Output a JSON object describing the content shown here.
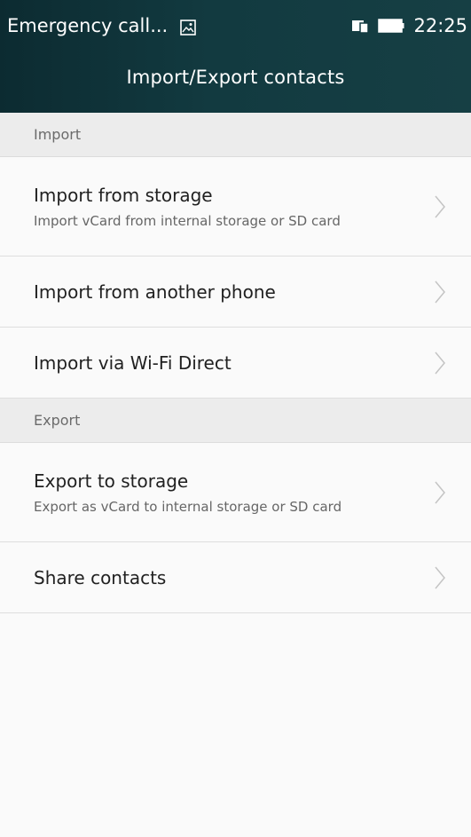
{
  "status_bar": {
    "carrier_text": "Emergency call...",
    "left_icon": "image-notification-icon",
    "right_icons": [
      "sim-card-icon",
      "battery-icon"
    ],
    "time": "22:25"
  },
  "header": {
    "title": "Import/Export contacts"
  },
  "sections": [
    {
      "label": "Import",
      "items": [
        {
          "title": "Import from storage",
          "subtitle": "Import vCard from internal storage or SD card"
        },
        {
          "title": "Import from another phone"
        },
        {
          "title": "Import via Wi-Fi Direct"
        }
      ]
    },
    {
      "label": "Export",
      "items": [
        {
          "title": "Export to storage",
          "subtitle": "Export as vCard to internal storage or SD card"
        },
        {
          "title": "Share contacts"
        }
      ]
    }
  ],
  "colors": {
    "header_bg": "#123a40",
    "section_bg": "#ececec",
    "list_bg": "#fafafa",
    "divider": "#dedede"
  }
}
